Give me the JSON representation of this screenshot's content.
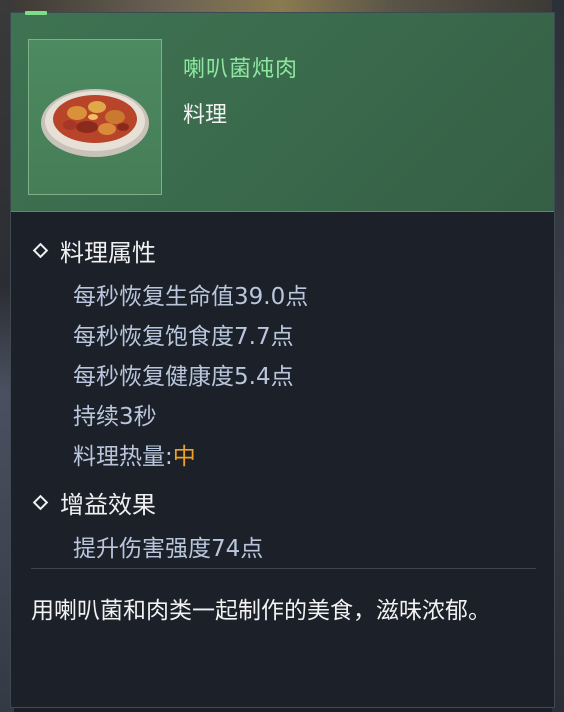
{
  "item": {
    "name": "喇叭菌炖肉",
    "type": "料理"
  },
  "cooking_attrs": {
    "title": "料理属性",
    "lines": [
      "每秒恢复生命值39.0点",
      "每秒恢复饱食度7.7点",
      "每秒恢复健康度5.4点",
      "持续3秒"
    ],
    "heat_label": "料理热量:",
    "heat_value": "中"
  },
  "buff": {
    "title": "增益效果",
    "lines": [
      "提升伤害强度74点"
    ]
  },
  "description": "用喇叭菌和肉类一起制作的美食，滋味浓郁。",
  "colors": {
    "header_green": "#3e7352",
    "name_green": "#8ce8a0",
    "attr_blue": "#b9c6dc",
    "heat_orange": "#f0a020"
  },
  "icon": "stew-dish-icon"
}
